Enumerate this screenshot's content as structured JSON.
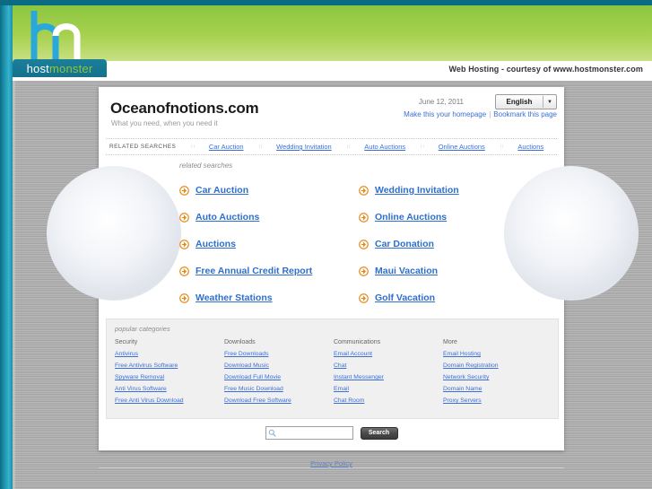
{
  "browser_chrome": {
    "hosting_credit": "Web Hosting - courtesy of www.hostmonster.com",
    "logo_tab": {
      "part1": "host",
      "part2": "monster"
    }
  },
  "site": {
    "title": "Oceanofnotions.com",
    "tagline": "What you need, when you need it",
    "date": "June 12, 2011",
    "language": "English",
    "language_arrow": "▼",
    "make_homepage": "Make this your homepage",
    "bookmark": "Bookmark this page",
    "link_separator": "|"
  },
  "nav": {
    "label": "RELATED SEARCHES",
    "separator": "∷",
    "items": [
      {
        "label": "Car Auction"
      },
      {
        "label": "Wedding Invitation"
      },
      {
        "label": "Auto Auctions"
      },
      {
        "label": "Online Auctions"
      },
      {
        "label": "Auctions"
      }
    ]
  },
  "related_searches": {
    "caption": "related searches",
    "items": [
      {
        "label": "Car Auction"
      },
      {
        "label": "Wedding Invitation"
      },
      {
        "label": "Auto Auctions"
      },
      {
        "label": "Online Auctions"
      },
      {
        "label": "Auctions"
      },
      {
        "label": "Car Donation"
      },
      {
        "label": "Free Annual Credit Report"
      },
      {
        "label": "Maui Vacation"
      },
      {
        "label": "Weather Stations"
      },
      {
        "label": "Golf Vacation"
      }
    ]
  },
  "popular_categories": {
    "caption": "popular categories",
    "columns": [
      {
        "title": "Security",
        "links": [
          "Antivirus",
          "Free Antivirus Software",
          "Spyware Removal",
          "Anti Virus Software",
          "Free Anti Virus Download"
        ]
      },
      {
        "title": "Downloads",
        "links": [
          "Free Downloads",
          "Download Music",
          "Download Full Movie",
          "Free Music Download",
          "Download Free Software"
        ]
      },
      {
        "title": "Communications",
        "links": [
          "Email Account",
          "Chat",
          "Instant Messenger",
          "Email",
          "Chat Room"
        ]
      },
      {
        "title": "More",
        "links": [
          "Email Hosting",
          "Domain Registration",
          "Network Security",
          "Domain Name",
          "Proxy Servers"
        ]
      }
    ]
  },
  "search": {
    "value": "",
    "placeholder": "",
    "button_label": "Search"
  },
  "footer": {
    "privacy_policy": "Privacy Policy"
  },
  "colors": {
    "brand_green": "#8cc63f",
    "brand_teal": "#1b7f9b",
    "link_blue": "#3a6fd8",
    "search_link_blue": "#2d6fd0",
    "arrow_orange": "#e8891a"
  }
}
